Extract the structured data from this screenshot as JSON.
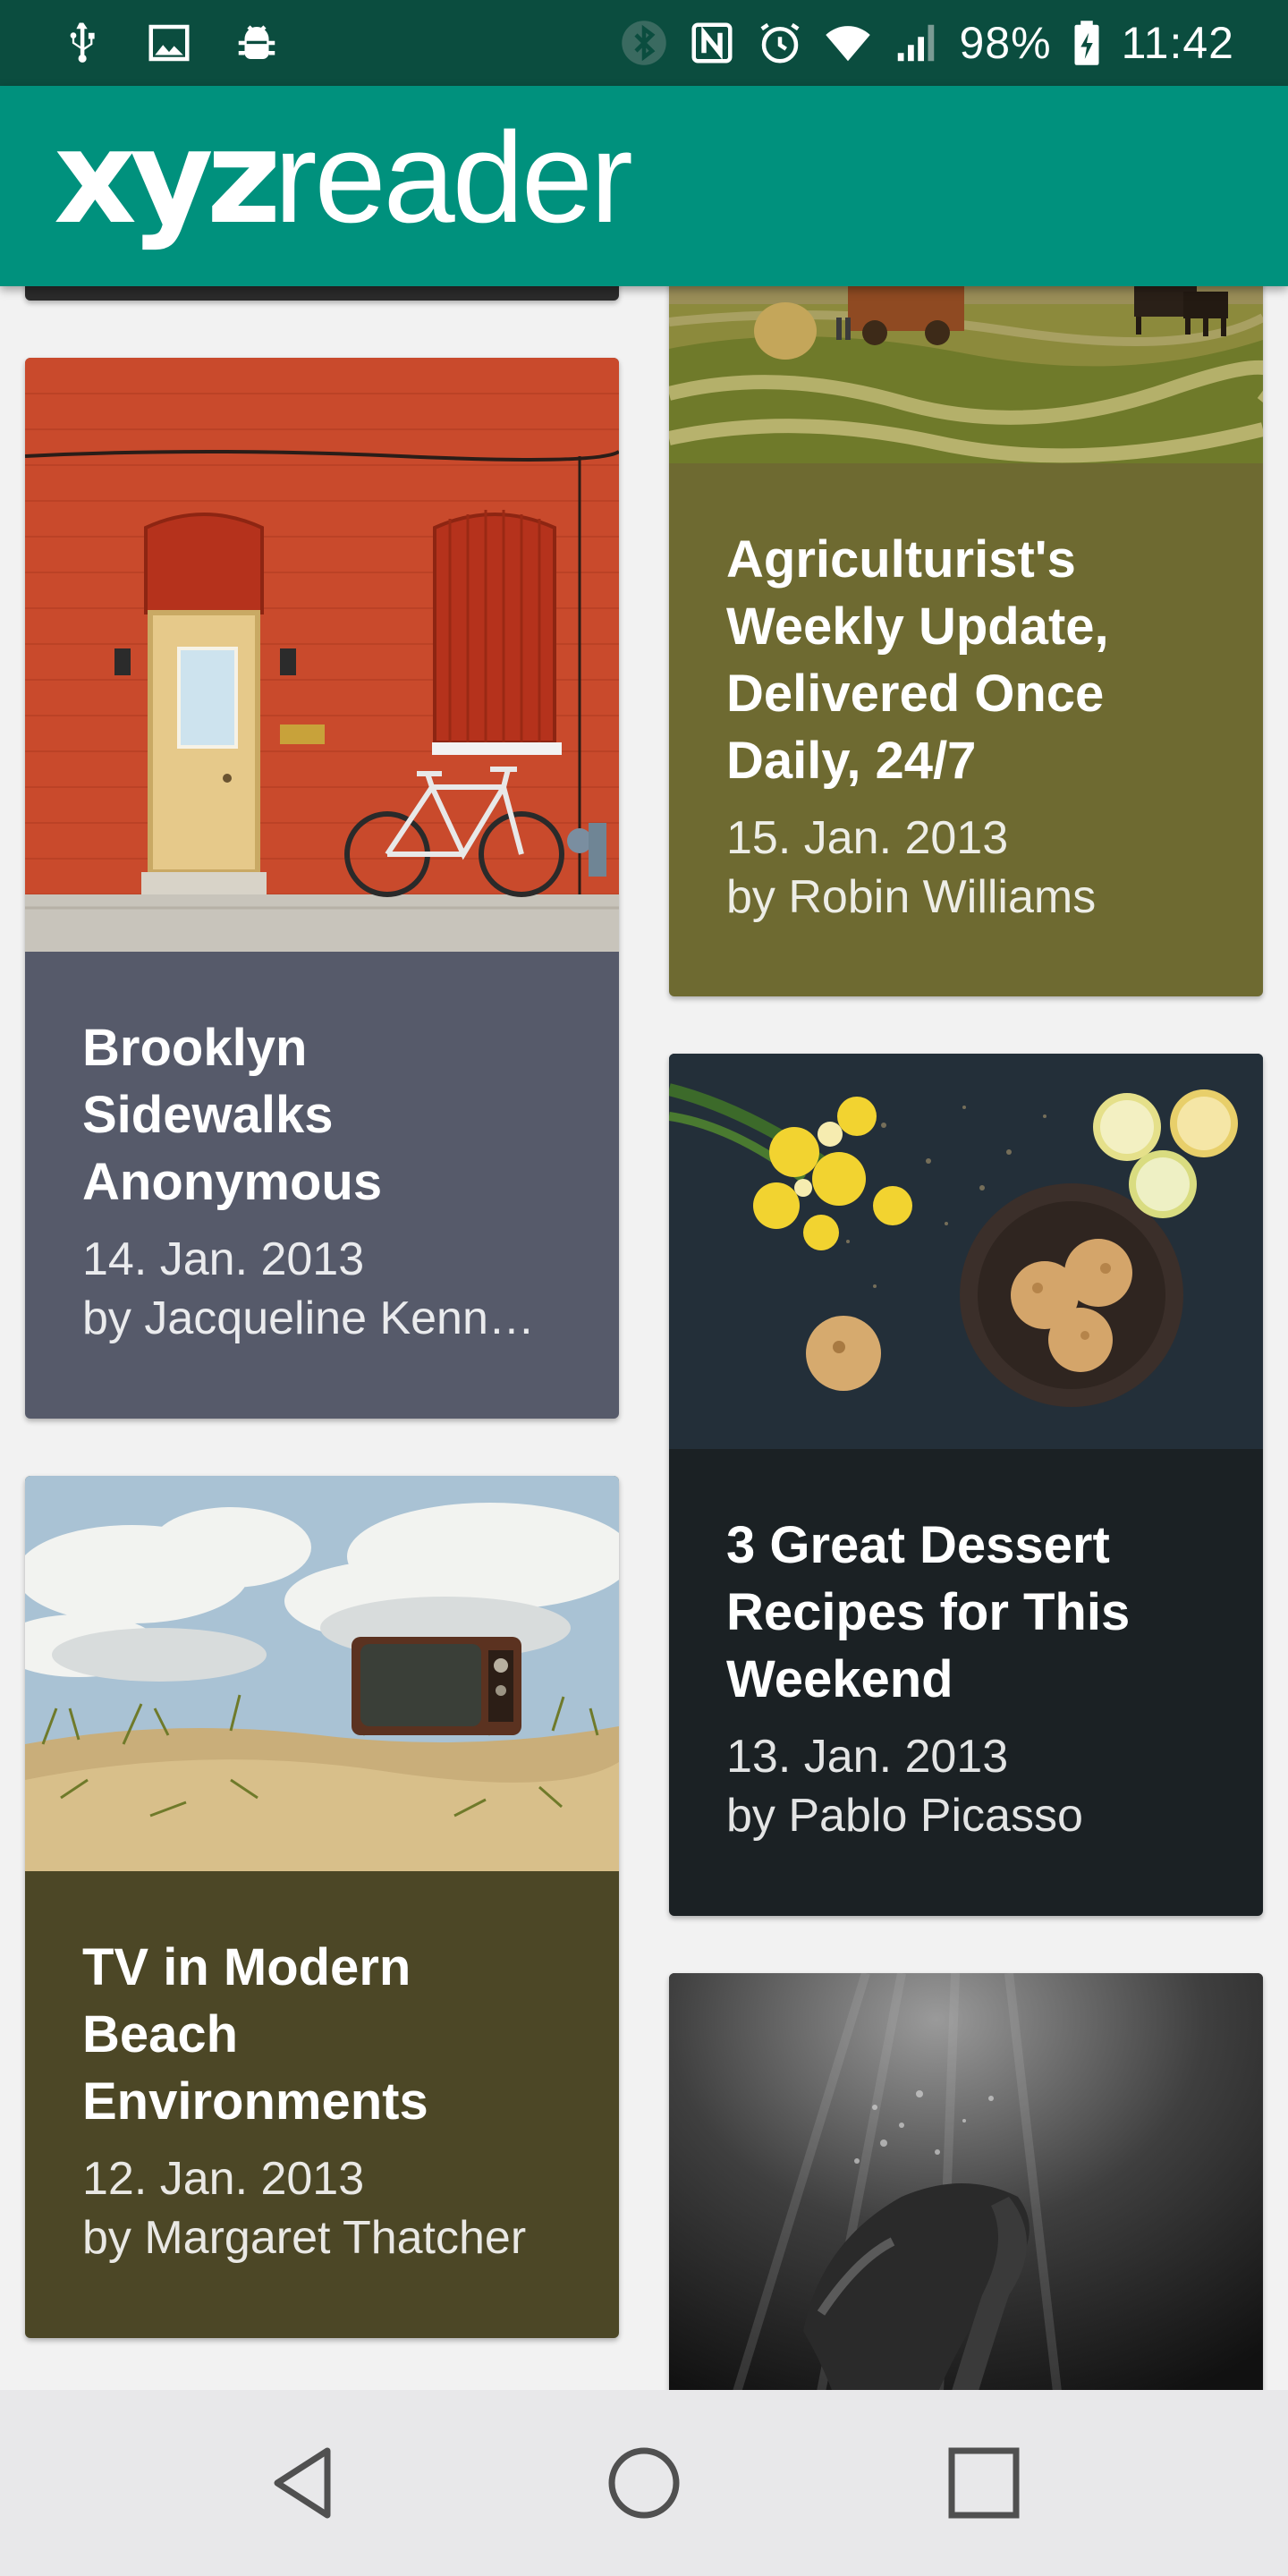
{
  "status_bar": {
    "battery": "98%",
    "time": "11:42",
    "left_icons": [
      "usb-icon",
      "image-icon",
      "android-debug-icon"
    ],
    "right_icons": [
      "bluetooth-icon",
      "nfc-icon",
      "alarm-icon",
      "wifi-icon",
      "signal-icon",
      "battery-icon"
    ]
  },
  "app_bar": {
    "logo_bold": "xyz",
    "logo_regular": "reader",
    "color": "#00917d"
  },
  "articles": [
    {
      "title": "Agriculturist's Weekly Update, Delivered Once Daily, 24/7",
      "date": "15. Jan. 2013",
      "author": "by Robin Williams",
      "color": "#6e6a31"
    },
    {
      "title": "Brooklyn Sidewalks Anonymous",
      "date": "14. Jan. 2013",
      "author": "by Jacqueline Kenn…",
      "color": "#565a6a"
    },
    {
      "title": "3 Great Dessert Recipes for This Weekend",
      "date": "13. Jan. 2013",
      "author": "by Pablo Picasso",
      "color": "#1b2124"
    },
    {
      "title": "TV in Modern Beach Environments",
      "date": "12. Jan. 2013",
      "author": "by Margaret Thatcher",
      "color": "#4c4726"
    }
  ],
  "nav_bar": {
    "buttons": [
      "back-icon",
      "home-icon",
      "recents-icon"
    ]
  }
}
